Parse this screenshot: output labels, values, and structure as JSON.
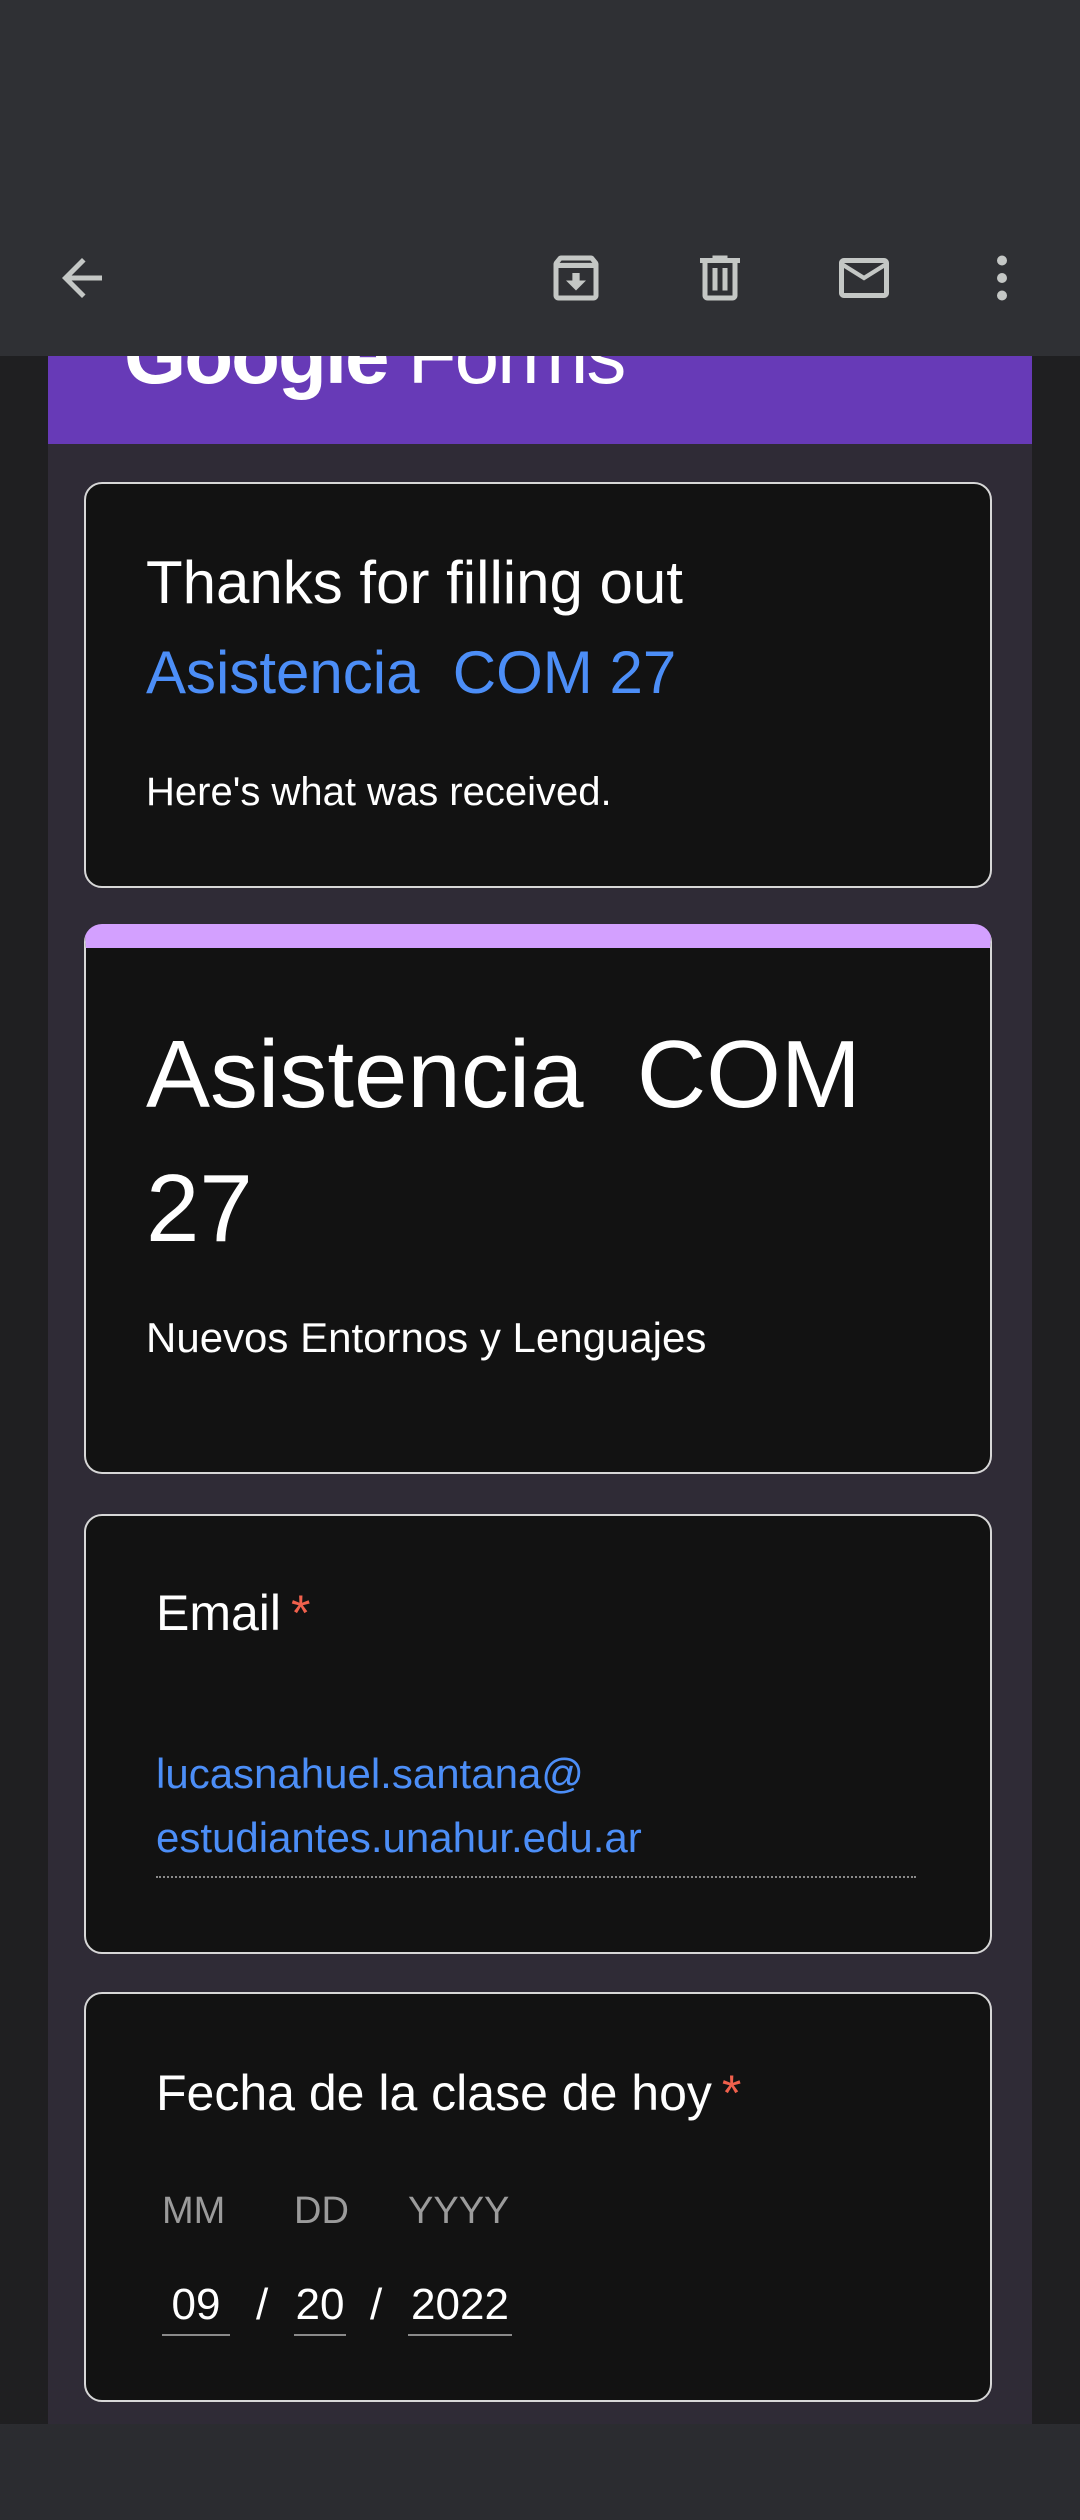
{
  "toolbar": {
    "icons": [
      "back-arrow-icon",
      "archive-icon",
      "delete-icon",
      "mark-unread-icon",
      "more-options-icon"
    ]
  },
  "header": {
    "logo_bold": "Google",
    "logo_light": "Forms",
    "color": "#673ab7"
  },
  "confirmation": {
    "thanks": "Thanks for filling out",
    "form_link": "Asistencia  COM 27",
    "subtitle": "Here's what was received."
  },
  "form": {
    "title": "Asistencia  COM 27",
    "description": "Nuevos Entornos y Lenguajes",
    "accent_color": "#d3a0ff"
  },
  "questions": {
    "email": {
      "label": "Email",
      "required_mark": "*",
      "value_line1": "lucasnahuel.santana@",
      "value_line2": "estudiantes.unahur.edu.ar"
    },
    "date": {
      "label": "Fecha de la clase de hoy",
      "required_mark": "*",
      "mm_label": "MM",
      "dd_label": "DD",
      "yyyy_label": "YYYY",
      "mm": "09",
      "dd": "20",
      "yyyy": "2022",
      "separator": "/"
    }
  }
}
